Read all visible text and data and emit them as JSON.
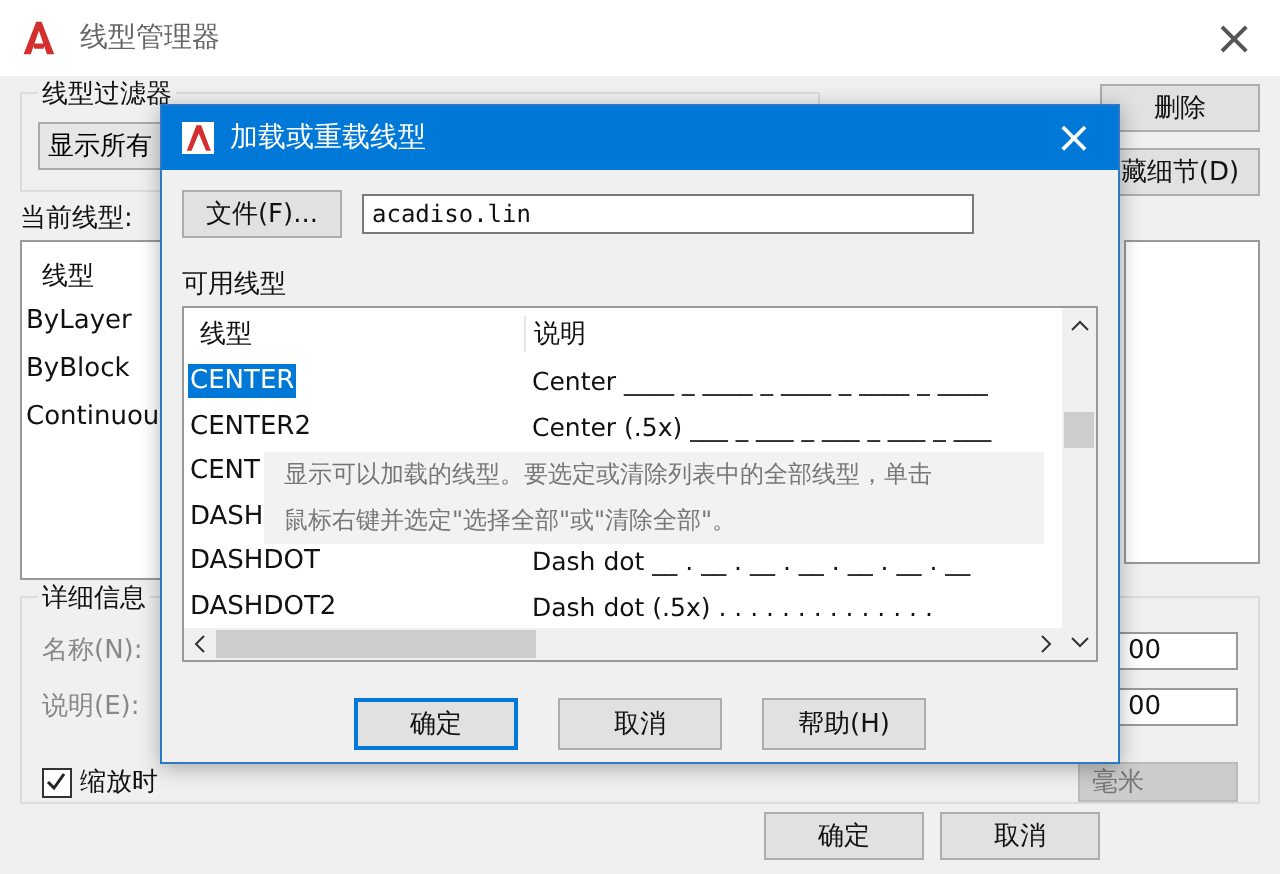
{
  "window": {
    "title": "线型管理器",
    "close": "×"
  },
  "filter": {
    "label": "线型过滤器",
    "value": "显示所有"
  },
  "side_buttons": [
    "删除",
    "藏细节(D)"
  ],
  "current_label": "当前线型:",
  "current_list": {
    "header": "线型",
    "rows": [
      "ByLayer",
      "ByBlock",
      "Continuou"
    ]
  },
  "details": {
    "label": "详细信息",
    "name_label": "名称(N):",
    "desc_label": "说明(E):",
    "scale_checkbox": {
      "label": "缩放时",
      "checked": true
    },
    "field_1": "00",
    "field_2": "00",
    "unit": "毫米"
  },
  "bottom_buttons": [
    "确定",
    "取消"
  ],
  "dialog": {
    "title": "加载或重载线型",
    "close": "×",
    "file_button": "文件(F)...",
    "file_value": "acadiso.lin",
    "list_label": "可用线型",
    "columns": [
      "线型",
      "说明"
    ],
    "rows": [
      {
        "name": "CENTER",
        "desc": "Center ____ _ ____ _ ____ _ ____ _ ____",
        "selected": true
      },
      {
        "name": "CENTER2",
        "desc": "Center (.5x) ___ _ ___ _ ___ _ ___ _ ___",
        "selected": false
      },
      {
        "name": "CENT",
        "selected": false
      },
      {
        "name": "DASH",
        "selected": false
      },
      {
        "name": "DASHDOT",
        "desc": "Dash dot __ . __ . __ . __ . __ . __ . __",
        "selected": false
      },
      {
        "name": "DASHDOT2",
        "desc": "Dash dot (.5x) . . . . . . . . . . . . . .",
        "selected": false
      }
    ],
    "buttons": [
      {
        "label": "确定",
        "focused": true
      },
      {
        "label": "取消",
        "focused": false
      },
      {
        "label": "帮助(H)",
        "focused": false
      }
    ],
    "tooltip": [
      "显示可以加载的线型。要选定或清除列表中的全部线型，单击",
      "鼠标右键并选定\"选择全部\"或\"清除全部\"。"
    ]
  }
}
